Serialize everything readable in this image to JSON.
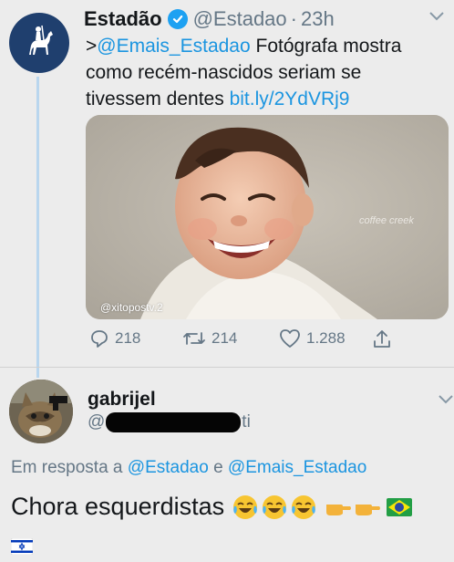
{
  "tweet": {
    "display_name": "Estadão",
    "handle": "@Estadao",
    "separator": "·",
    "time": "23h",
    "text_prefix": ">",
    "mention": "@Emais_Estadao",
    "text_body": " Fotógrafa mostra como recém-nascidos seriam se tivessem dentes ",
    "link": "bit.ly/2YdVRj9",
    "media": {
      "watermark": "@xitopostv.2",
      "signature": "coffee creek"
    },
    "actions": {
      "replies": "218",
      "retweets": "214",
      "likes": "1.288"
    }
  },
  "reply": {
    "display_name": "gabrijel",
    "handle_visible": "@",
    "handle_tail": "ti",
    "replying_prefix": "Em resposta a ",
    "replying_to_1": "@Estadao",
    "replying_and": " e ",
    "replying_to_2": "@Emais_Estadao",
    "text": "Chora esquerdistas",
    "emojis": [
      "face-with-tears-of-joy",
      "face-with-tears-of-joy",
      "face-with-tears-of-joy",
      "pointing-hand",
      "pointing-hand",
      "brazil-flag"
    ],
    "bottom_emoji": "israel-flag"
  },
  "colors": {
    "link": "#1b95e0",
    "muted": "#657786",
    "verified": "#1da1f2",
    "thread_line": "#b9d6ee",
    "avatar_bg": "#1f3f6e"
  }
}
